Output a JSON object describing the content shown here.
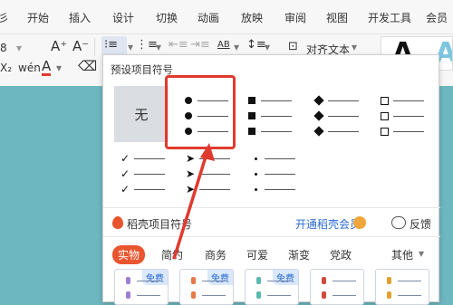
{
  "ribbon": {
    "tabs": [
      "彡",
      "开始",
      "插入",
      "设计",
      "切换",
      "动画",
      "放映",
      "审阅",
      "视图",
      "开发工具",
      "会员"
    ],
    "font_size": "8",
    "increase_font": "A⁺",
    "decrease_font": "A⁻",
    "clear_format": "⌫",
    "strike_label": "X₂",
    "phonetic_label": "wén",
    "font_color_label": "A",
    "highlight_label": "A",
    "align_text_label": "对齐文本",
    "ab_label": "AB"
  },
  "panel": {
    "title": "预设项目符号",
    "none_label": "无",
    "daoke_label": "稻壳项目符号",
    "open_vip_label": "开通稻壳会员",
    "feedback_label": "反馈",
    "categories": [
      "实物",
      "简约",
      "商务",
      "可爱",
      "渐变",
      "党政"
    ],
    "more_label": "其他",
    "free_label": "免费"
  },
  "colors": {
    "accent": "#e9552e",
    "highlight_box": "#e03a2f",
    "link": "#2a6ad0"
  }
}
